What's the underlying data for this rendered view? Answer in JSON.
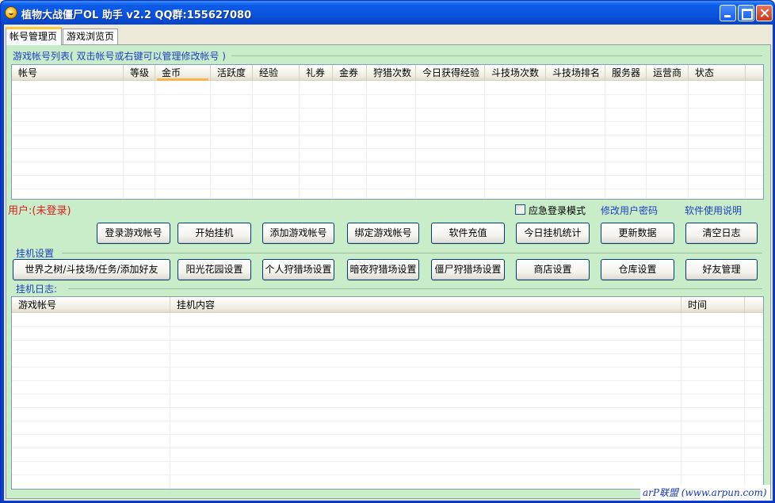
{
  "window": {
    "title": "植物大战僵尸OL 助手 v2.2 QQ群:155627080"
  },
  "tabs": [
    {
      "label": "帐号管理页"
    },
    {
      "label": "游戏浏览页"
    }
  ],
  "accounts": {
    "label": "游戏帐号列表( 双击帐号或右键可以管理修改帐号 )",
    "columns": [
      "帐号",
      "等级",
      "金币",
      "活跃度",
      "经验",
      "礼券",
      "金券",
      "狩猎次数",
      "今日获得经验",
      "斗技场次数",
      "斗技场排名",
      "服务器",
      "运营商",
      "状态"
    ],
    "sorted_column": "金币"
  },
  "user_status": "用户:(未登录)",
  "emergency_login": {
    "label": "应急登录模式",
    "checked": false
  },
  "links": {
    "change_password": "修改用户密码",
    "manual": "软件使用说明"
  },
  "buttons_row1": [
    "登录游戏帐号",
    "开始挂机",
    "添加游戏帐号",
    "绑定游戏帐号",
    "软件充值",
    "今日挂机统计",
    "更新数据",
    "清空日志"
  ],
  "settings": {
    "label": "挂机设置",
    "buttons": [
      "世界之树/斗技场/任务/添加好友",
      "阳光花园设置",
      "个人狩猎场设置",
      "暗夜狩猎场设置",
      "僵尸狩猎场设置",
      "商店设置",
      "仓库设置",
      "好友管理"
    ]
  },
  "log": {
    "label": "挂机日志:",
    "columns": [
      "游戏帐号",
      "挂机内容",
      "时间"
    ]
  },
  "watermark": "arP联盟 (www.arpun.com)",
  "colors": {
    "title_bar": "#0b53de",
    "panel_bg": "#c9ecc9",
    "group_label": "#1e40c8",
    "status_red": "#e21b1b",
    "sort_indicator": "#f9b44a"
  }
}
